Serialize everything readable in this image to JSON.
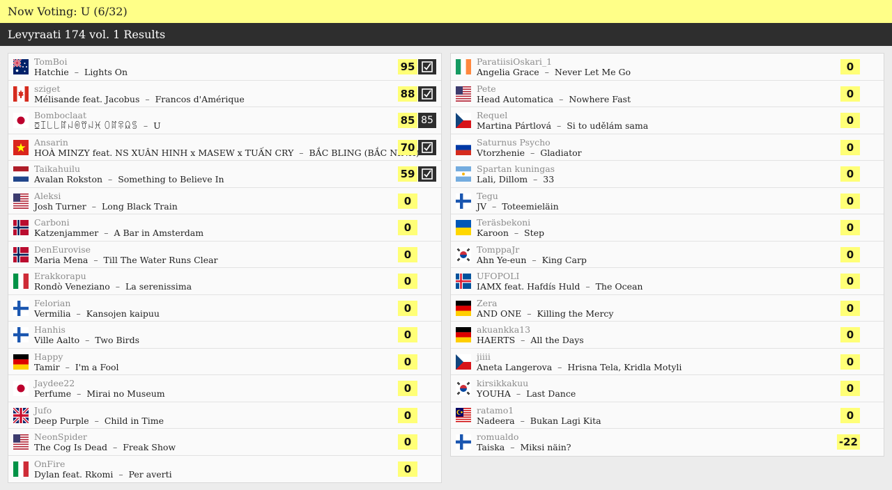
{
  "header": {
    "voting": "Now Voting: U (6/32)",
    "results": "Levyraati 174 vol. 1 Results"
  },
  "left": [
    {
      "user": "TomBoi",
      "artist": "Hatchie",
      "title": "Lights On",
      "score": "95",
      "badge": "check",
      "flag": "au"
    },
    {
      "user": "sziget",
      "artist": "Mélisande feat. Jacobus",
      "title": "Francos d'Amérique",
      "score": "88",
      "badge": "check",
      "flag": "ca"
    },
    {
      "user": "Bomboclaat",
      "artist": "ꗞꀤ꒒꒒ꍏꈤꉻꀎꈤꁝ ꄲꍏꋖꆰꌚ",
      "title": "U",
      "score": "85",
      "badge": "85",
      "flag": "jp"
    },
    {
      "user": "Ansarin",
      "artist": "HOÀ MINZY feat. NS XUÂN HINH x MASEW x TUẤN CRY",
      "title": "BẮC BLING (BẮC NINH)",
      "score": "70",
      "badge": "check",
      "flag": "vn"
    },
    {
      "user": "Taikahuilu",
      "artist": "Avalan Rokston",
      "title": "Something to Believe In",
      "score": "59",
      "badge": "check",
      "flag": "nl"
    },
    {
      "user": "Aleksi",
      "artist": "Josh Turner",
      "title": "Long Black Train",
      "score": "0",
      "badge": "",
      "flag": "us"
    },
    {
      "user": "Carboni",
      "artist": "Katzenjammer",
      "title": "A Bar in Amsterdam",
      "score": "0",
      "badge": "",
      "flag": "no"
    },
    {
      "user": "DenEurovise",
      "artist": "Maria Mena",
      "title": "Till The Water Runs Clear",
      "score": "0",
      "badge": "",
      "flag": "no"
    },
    {
      "user": "Erakkorapu",
      "artist": "Rondò Veneziano",
      "title": "La serenissima",
      "score": "0",
      "badge": "",
      "flag": "it"
    },
    {
      "user": "Felorian",
      "artist": "Vermilia",
      "title": "Kansojen kaipuu",
      "score": "0",
      "badge": "",
      "flag": "fi"
    },
    {
      "user": "Hanhis",
      "artist": "Ville Aalto",
      "title": "Two Birds",
      "score": "0",
      "badge": "",
      "flag": "fi"
    },
    {
      "user": "Happy",
      "artist": "Tamir",
      "title": "I'm a Fool",
      "score": "0",
      "badge": "",
      "flag": "de"
    },
    {
      "user": "Jaydee22",
      "artist": "Perfume",
      "title": "Mirai no Museum",
      "score": "0",
      "badge": "",
      "flag": "jp"
    },
    {
      "user": "Jufo",
      "artist": "Deep Purple",
      "title": "Child in Time",
      "score": "0",
      "badge": "",
      "flag": "gb"
    },
    {
      "user": "NeonSpider",
      "artist": "The Cog Is Dead",
      "title": "Freak Show",
      "score": "0",
      "badge": "",
      "flag": "us"
    },
    {
      "user": "OnFire",
      "artist": "Dylan feat. Rkomi",
      "title": "Per averti",
      "score": "0",
      "badge": "",
      "flag": "it"
    }
  ],
  "right": [
    {
      "user": "ParatiisiOskari_1",
      "artist": "Angelia Grace",
      "title": "Never Let Me Go",
      "score": "0",
      "flag": "ie"
    },
    {
      "user": "Pete",
      "artist": "Head Automatica",
      "title": "Nowhere Fast",
      "score": "0",
      "flag": "us"
    },
    {
      "user": "Requel",
      "artist": "Martina Pártlová",
      "title": "Si to udělám sama",
      "score": "0",
      "flag": "cz"
    },
    {
      "user": "Saturnus Psycho",
      "artist": "Vtorzhenie",
      "title": "Gladiator",
      "score": "0",
      "flag": "ru"
    },
    {
      "user": "Spartan kuningas",
      "artist": "Lali, Dillom",
      "title": "33",
      "score": "0",
      "flag": "ar"
    },
    {
      "user": "Tegu",
      "artist": "JV",
      "title": "Toteemieläin",
      "score": "0",
      "flag": "fi"
    },
    {
      "user": "Teräsbekoni",
      "artist": "Karoon",
      "title": "Step",
      "score": "0",
      "flag": "ua"
    },
    {
      "user": "TomppaJr",
      "artist": "Ahn Ye-eun",
      "title": "King Carp",
      "score": "0",
      "flag": "kr"
    },
    {
      "user": "UFOPOLI",
      "artist": "IAMX feat. Hafdís Huld",
      "title": "The Ocean",
      "score": "0",
      "flag": "is"
    },
    {
      "user": "Zera",
      "artist": "AND ONE",
      "title": "Killing the Mercy",
      "score": "0",
      "flag": "de"
    },
    {
      "user": "akuankka13",
      "artist": "HAERTS",
      "title": "All the Days",
      "score": "0",
      "flag": "de"
    },
    {
      "user": "jiiii",
      "artist": "Aneta Langerova",
      "title": "Hrisna Tela, Kridla Motyli",
      "score": "0",
      "flag": "cz"
    },
    {
      "user": "kirsikkakuu",
      "artist": "YOUHA",
      "title": "Last Dance",
      "score": "0",
      "flag": "kr"
    },
    {
      "user": "ratamo1",
      "artist": "Nadeera",
      "title": "Bukan Lagi Kita",
      "score": "0",
      "flag": "my"
    },
    {
      "user": "romualdo",
      "artist": "Taiska",
      "title": "Miksi näin?",
      "score": "-22",
      "flag": "fi"
    }
  ],
  "separator": "–",
  "colors": {
    "highlight": "#ffff77",
    "dark": "#2e2e2e",
    "top": "#ffff88"
  }
}
